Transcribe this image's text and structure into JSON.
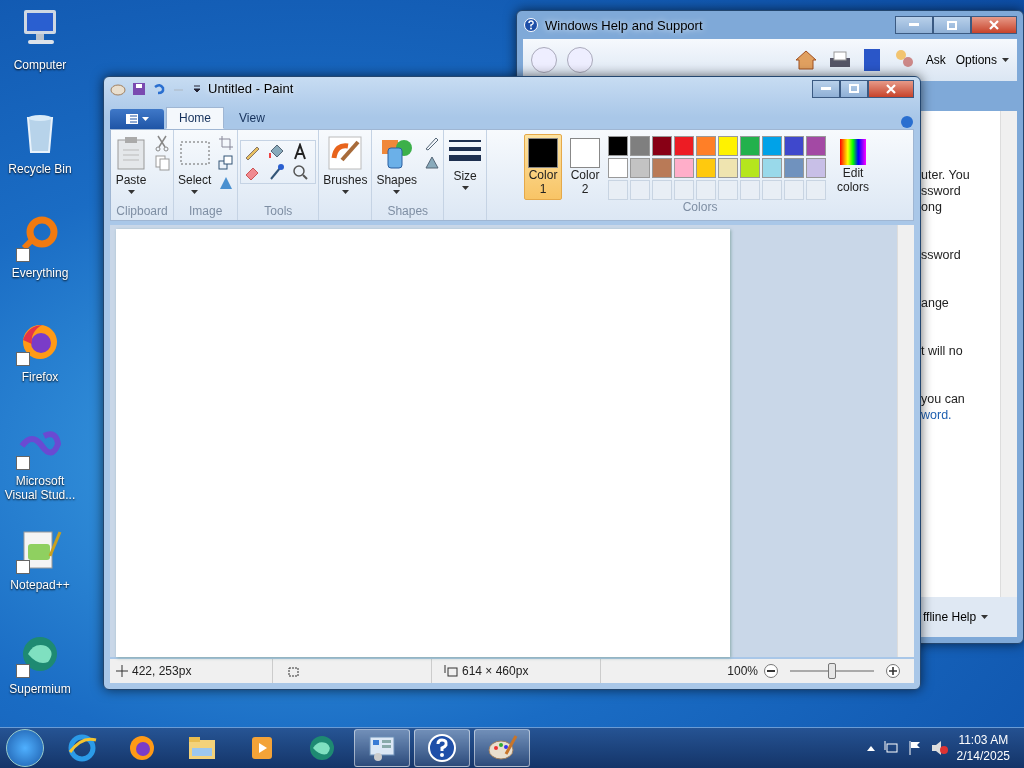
{
  "desktop_icons": [
    {
      "label": "Computer",
      "kind": "computer",
      "shortcut": false
    },
    {
      "label": "Recycle Bin",
      "kind": "recycle",
      "shortcut": false
    },
    {
      "label": "Everything",
      "kind": "everything",
      "shortcut": true
    },
    {
      "label": "Firefox",
      "kind": "firefox",
      "shortcut": true
    },
    {
      "label": "Microsoft Visual Stud...",
      "kind": "vs",
      "shortcut": true
    },
    {
      "label": "Notepad++",
      "kind": "notepad",
      "shortcut": true
    },
    {
      "label": "Supermium",
      "kind": "supermium",
      "shortcut": true
    }
  ],
  "help_window": {
    "title": "Windows Help and Support",
    "toolbar": [
      "Ask",
      "Options"
    ],
    "paragraphs": [
      {
        "lines": [
          "uter. You",
          "ssword",
          "ong"
        ]
      },
      {
        "lines": [
          "ssword"
        ]
      },
      {
        "lines": [
          "ange"
        ]
      },
      {
        "lines": [
          "t will no"
        ]
      },
      {
        "lines": [
          "you can"
        ],
        "link": "word."
      }
    ],
    "footer": "ffline Help"
  },
  "paint_window": {
    "title": "Untitled - Paint",
    "tabs": [
      {
        "label": "Home",
        "selected": true
      },
      {
        "label": "View",
        "selected": false
      }
    ],
    "groups": [
      {
        "kind": "clipboard",
        "label": "Clipboard",
        "button": "Paste"
      },
      {
        "kind": "image",
        "label": "Image",
        "button": "Select"
      },
      {
        "kind": "tools",
        "label": "Tools"
      },
      {
        "kind": "brushes",
        "button": "Brushes"
      },
      {
        "kind": "shapes",
        "label": "Shapes",
        "button": "Shapes"
      },
      {
        "kind": "size",
        "button": "Size"
      }
    ],
    "colors": {
      "label": "Colors",
      "edit": "Edit colors",
      "slots": [
        {
          "label": "Color 1",
          "color": "#000000",
          "selected": true
        },
        {
          "label": "Color 2",
          "color": "#ffffff",
          "selected": false
        }
      ],
      "palette": [
        {
          "color": "#000000"
        },
        {
          "color": "#7f7f7f"
        },
        {
          "color": "#880015"
        },
        {
          "color": "#ed1c24"
        },
        {
          "color": "#ff7f27"
        },
        {
          "color": "#fff200"
        },
        {
          "color": "#22b14c"
        },
        {
          "color": "#00a2e8"
        },
        {
          "color": "#3f48cc"
        },
        {
          "color": "#a349a4"
        },
        {
          "color": "#ffffff"
        },
        {
          "color": "#c3c3c3"
        },
        {
          "color": "#b97a57"
        },
        {
          "color": "#ffaec9"
        },
        {
          "color": "#ffc90e"
        },
        {
          "color": "#efe4b0"
        },
        {
          "color": "#b5e61d"
        },
        {
          "color": "#99d9ea"
        },
        {
          "color": "#7092be"
        },
        {
          "color": "#c8bfe7"
        }
      ]
    },
    "status": {
      "position": "422, 253px",
      "size": "614 × 460px",
      "zoom": "100%",
      "zoom_slider": {
        "level": 0.5
      }
    }
  },
  "taskbar": {
    "items": [
      {
        "kind": "ie",
        "running": false
      },
      {
        "kind": "firefox",
        "running": false
      },
      {
        "kind": "explorer",
        "running": false
      },
      {
        "kind": "media",
        "running": false
      },
      {
        "kind": "supermium",
        "running": false
      },
      {
        "kind": "controlpanel",
        "running": true
      },
      {
        "kind": "help",
        "running": true
      },
      {
        "kind": "paint",
        "running": true
      }
    ],
    "time": "11:03 AM",
    "date": "2/14/2025"
  }
}
